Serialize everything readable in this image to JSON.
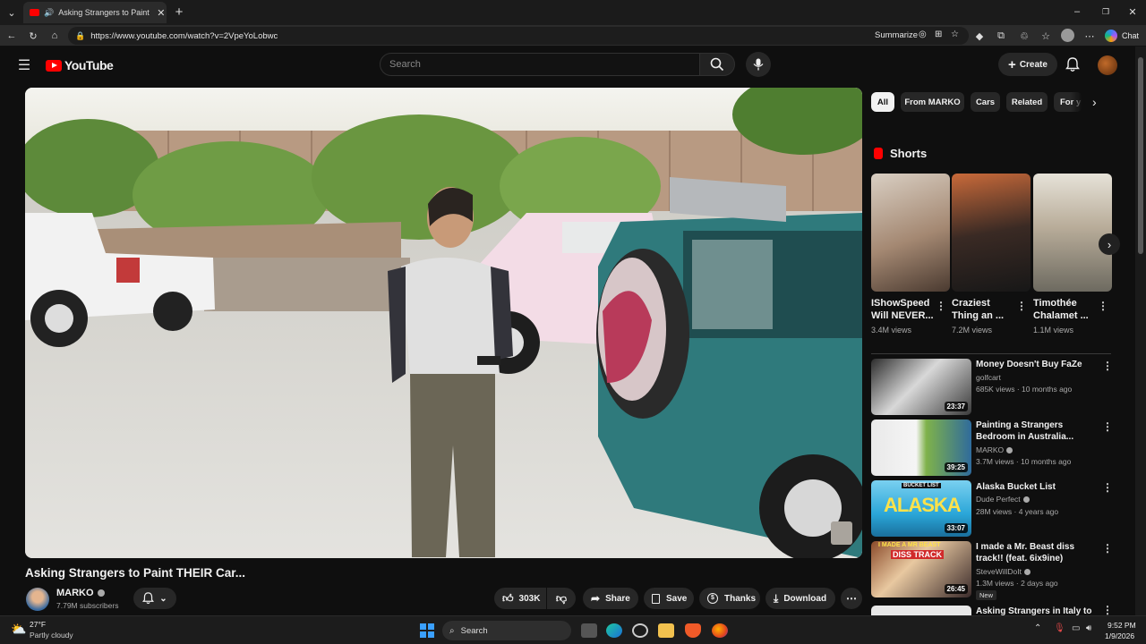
{
  "browser": {
    "tab_title": "Asking Strangers to Paint THEIR Car...",
    "url": "https://www.youtube.com/watch?v=2VpeYoLobwc",
    "summarize_label": "Summarize",
    "chat_label": "Chat"
  },
  "header": {
    "logo_text": "YouTube",
    "search_placeholder": "Search",
    "create_label": "Create"
  },
  "video": {
    "title": "Asking Strangers to Paint THEIR Car...",
    "channel": "MARKO",
    "subscribers": "7.79M subscribers",
    "likes": "303K",
    "share_label": "Share",
    "save_label": "Save",
    "thanks_label": "Thanks",
    "download_label": "Download"
  },
  "filters": [
    "All",
    "From MARKO",
    "Cars",
    "Related",
    "For y"
  ],
  "shorts": {
    "heading": "Shorts",
    "items": [
      {
        "title": "IShowSpeed Will NEVER...",
        "views": "3.4M views"
      },
      {
        "title": "Craziest Thing an ...",
        "views": "7.2M views"
      },
      {
        "title": "Timothée Chalamet ...",
        "views": "1.1M views"
      }
    ]
  },
  "recommendations": [
    {
      "title": "Money Doesn't Buy FaZe",
      "channel": "golfcart",
      "meta": "685K views · 10 months ago",
      "duration": "23:37",
      "thumb_text": ""
    },
    {
      "title": "Painting a Strangers Bedroom in Australia...",
      "channel": "MARKO",
      "meta": "3.7M views · 10 months ago",
      "duration": "39:25",
      "thumb_text": ""
    },
    {
      "title": "Alaska Bucket List",
      "channel": "Dude Perfect",
      "meta": "28M views · 4 years ago",
      "duration": "33:07",
      "thumb_text": "ALASKA",
      "thumb_subtext": "BUCKET LIST"
    },
    {
      "title": "I made a Mr. Beast diss track!! (feat. 6ix9ine)",
      "channel": "SteveWillDoIt",
      "meta": "1.3M views · 2 days ago",
      "duration": "26:45",
      "badge": "New",
      "thumb_text": "I MADE A MR BEAST",
      "thumb_subtext": "DISS TRACK"
    },
    {
      "title": "Asking Strangers in Italy to",
      "channel": "",
      "meta": "",
      "duration": "",
      "thumb_text": ""
    }
  ],
  "taskbar": {
    "weather_temp": "27°F",
    "weather_desc": "Partly cloudy",
    "search_label": "Search",
    "time": "9:52 PM",
    "date": "1/9/2026"
  },
  "colors": {
    "background": "#0f0f0f",
    "youtube_red": "#ff0000",
    "chip_bg": "#272727",
    "text_secondary": "#aaaaaa"
  }
}
